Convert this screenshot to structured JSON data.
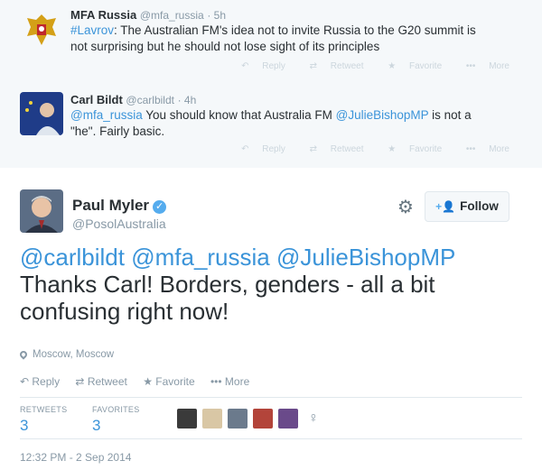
{
  "reply_tweets": [
    {
      "name": "MFA Russia",
      "handle": "@mfa_russia",
      "time": "· 5h",
      "hashtag": "#Lavrov",
      "text_line1": ": The Australian FM's idea not to invite Russia to the G20 summit is",
      "text_line2": "not surprising but he should not lose sight of its principles",
      "actions": [
        "Reply",
        "Retweet",
        "Favorite",
        "More"
      ]
    },
    {
      "name": "Carl Bildt",
      "handle": "@carlbildt",
      "time": "· 4h",
      "mention1": "@mfa_russia",
      "text_mid": " You should know that Australia FM ",
      "mention2": "@JulieBishopMP",
      "text_end1": " is not a",
      "text_line2": "\"he\". Fairly basic.",
      "actions": [
        "Reply",
        "Retweet",
        "Favorite",
        "More"
      ]
    }
  ],
  "main_tweet": {
    "name": "Paul Myler",
    "handle": "@PosolAustralia",
    "follow_label": "Follow",
    "mentions": "@carlbildt @mfa_russia @JulieBishopMP",
    "text_line1": "Thanks Carl! Borders, genders - all a bit",
    "text_line2": "confusing right now!",
    "location": "Moscow, Moscow",
    "actions": [
      "Reply",
      "Retweet",
      "Favorite",
      "More"
    ],
    "retweets_label": "RETWEETS",
    "retweets_count": "3",
    "favorites_label": "FAVORITES",
    "favorites_count": "3",
    "timestamp": "12:32 PM - 2 Sep 2014"
  },
  "colors": {
    "link": "#3b94d9",
    "verified": "#55acee",
    "meta": "#8899a6"
  },
  "icons": [
    "reply-icon",
    "retweet-icon",
    "favorite-icon",
    "more-icon",
    "gear-icon",
    "verified-icon",
    "location-icon",
    "follow-icon"
  ]
}
